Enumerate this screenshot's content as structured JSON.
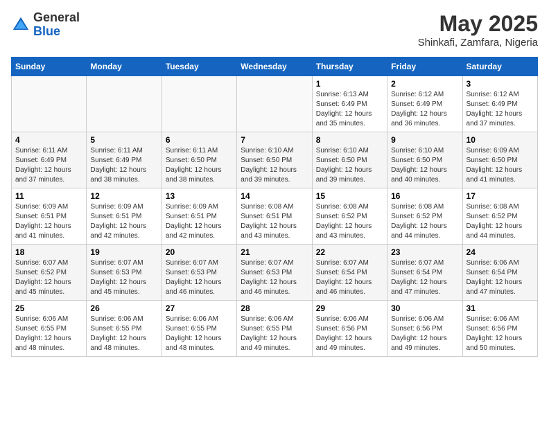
{
  "header": {
    "logo_line1": "General",
    "logo_line2": "Blue",
    "month": "May 2025",
    "location": "Shinkafi, Zamfara, Nigeria"
  },
  "weekdays": [
    "Sunday",
    "Monday",
    "Tuesday",
    "Wednesday",
    "Thursday",
    "Friday",
    "Saturday"
  ],
  "weeks": [
    [
      {
        "day": "",
        "info": ""
      },
      {
        "day": "",
        "info": ""
      },
      {
        "day": "",
        "info": ""
      },
      {
        "day": "",
        "info": ""
      },
      {
        "day": "1",
        "info": "Sunrise: 6:13 AM\nSunset: 6:49 PM\nDaylight: 12 hours\nand 35 minutes."
      },
      {
        "day": "2",
        "info": "Sunrise: 6:12 AM\nSunset: 6:49 PM\nDaylight: 12 hours\nand 36 minutes."
      },
      {
        "day": "3",
        "info": "Sunrise: 6:12 AM\nSunset: 6:49 PM\nDaylight: 12 hours\nand 37 minutes."
      }
    ],
    [
      {
        "day": "4",
        "info": "Sunrise: 6:11 AM\nSunset: 6:49 PM\nDaylight: 12 hours\nand 37 minutes."
      },
      {
        "day": "5",
        "info": "Sunrise: 6:11 AM\nSunset: 6:49 PM\nDaylight: 12 hours\nand 38 minutes."
      },
      {
        "day": "6",
        "info": "Sunrise: 6:11 AM\nSunset: 6:50 PM\nDaylight: 12 hours\nand 38 minutes."
      },
      {
        "day": "7",
        "info": "Sunrise: 6:10 AM\nSunset: 6:50 PM\nDaylight: 12 hours\nand 39 minutes."
      },
      {
        "day": "8",
        "info": "Sunrise: 6:10 AM\nSunset: 6:50 PM\nDaylight: 12 hours\nand 39 minutes."
      },
      {
        "day": "9",
        "info": "Sunrise: 6:10 AM\nSunset: 6:50 PM\nDaylight: 12 hours\nand 40 minutes."
      },
      {
        "day": "10",
        "info": "Sunrise: 6:09 AM\nSunset: 6:50 PM\nDaylight: 12 hours\nand 41 minutes."
      }
    ],
    [
      {
        "day": "11",
        "info": "Sunrise: 6:09 AM\nSunset: 6:51 PM\nDaylight: 12 hours\nand 41 minutes."
      },
      {
        "day": "12",
        "info": "Sunrise: 6:09 AM\nSunset: 6:51 PM\nDaylight: 12 hours\nand 42 minutes."
      },
      {
        "day": "13",
        "info": "Sunrise: 6:09 AM\nSunset: 6:51 PM\nDaylight: 12 hours\nand 42 minutes."
      },
      {
        "day": "14",
        "info": "Sunrise: 6:08 AM\nSunset: 6:51 PM\nDaylight: 12 hours\nand 43 minutes."
      },
      {
        "day": "15",
        "info": "Sunrise: 6:08 AM\nSunset: 6:52 PM\nDaylight: 12 hours\nand 43 minutes."
      },
      {
        "day": "16",
        "info": "Sunrise: 6:08 AM\nSunset: 6:52 PM\nDaylight: 12 hours\nand 44 minutes."
      },
      {
        "day": "17",
        "info": "Sunrise: 6:08 AM\nSunset: 6:52 PM\nDaylight: 12 hours\nand 44 minutes."
      }
    ],
    [
      {
        "day": "18",
        "info": "Sunrise: 6:07 AM\nSunset: 6:52 PM\nDaylight: 12 hours\nand 45 minutes."
      },
      {
        "day": "19",
        "info": "Sunrise: 6:07 AM\nSunset: 6:53 PM\nDaylight: 12 hours\nand 45 minutes."
      },
      {
        "day": "20",
        "info": "Sunrise: 6:07 AM\nSunset: 6:53 PM\nDaylight: 12 hours\nand 46 minutes."
      },
      {
        "day": "21",
        "info": "Sunrise: 6:07 AM\nSunset: 6:53 PM\nDaylight: 12 hours\nand 46 minutes."
      },
      {
        "day": "22",
        "info": "Sunrise: 6:07 AM\nSunset: 6:54 PM\nDaylight: 12 hours\nand 46 minutes."
      },
      {
        "day": "23",
        "info": "Sunrise: 6:07 AM\nSunset: 6:54 PM\nDaylight: 12 hours\nand 47 minutes."
      },
      {
        "day": "24",
        "info": "Sunrise: 6:06 AM\nSunset: 6:54 PM\nDaylight: 12 hours\nand 47 minutes."
      }
    ],
    [
      {
        "day": "25",
        "info": "Sunrise: 6:06 AM\nSunset: 6:55 PM\nDaylight: 12 hours\nand 48 minutes."
      },
      {
        "day": "26",
        "info": "Sunrise: 6:06 AM\nSunset: 6:55 PM\nDaylight: 12 hours\nand 48 minutes."
      },
      {
        "day": "27",
        "info": "Sunrise: 6:06 AM\nSunset: 6:55 PM\nDaylight: 12 hours\nand 48 minutes."
      },
      {
        "day": "28",
        "info": "Sunrise: 6:06 AM\nSunset: 6:55 PM\nDaylight: 12 hours\nand 49 minutes."
      },
      {
        "day": "29",
        "info": "Sunrise: 6:06 AM\nSunset: 6:56 PM\nDaylight: 12 hours\nand 49 minutes."
      },
      {
        "day": "30",
        "info": "Sunrise: 6:06 AM\nSunset: 6:56 PM\nDaylight: 12 hours\nand 49 minutes."
      },
      {
        "day": "31",
        "info": "Sunrise: 6:06 AM\nSunset: 6:56 PM\nDaylight: 12 hours\nand 50 minutes."
      }
    ]
  ]
}
